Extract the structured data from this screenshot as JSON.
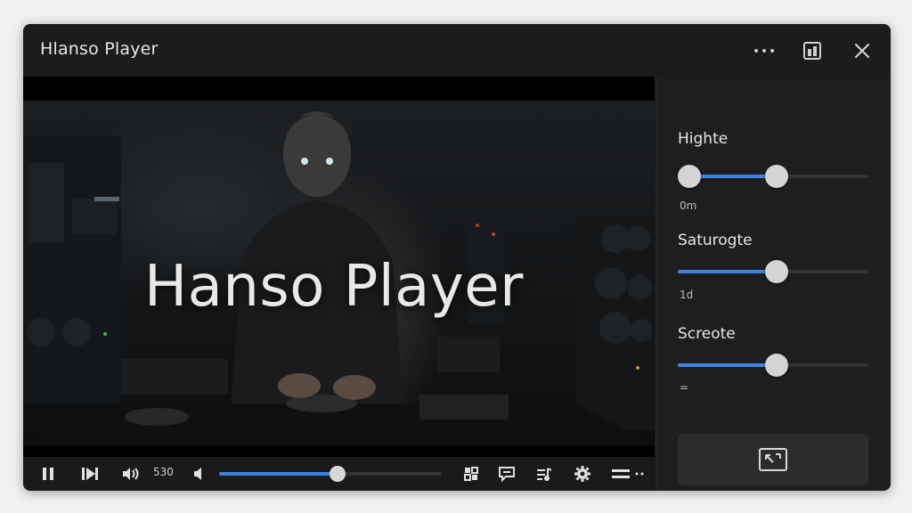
{
  "window": {
    "title": "Hlanso Player"
  },
  "video": {
    "overlay_title": "Hanso Player",
    "progress": 0.5
  },
  "controls": {
    "time": "530",
    "volume": 0.53
  },
  "adjustments": [
    {
      "label": "Highte",
      "value_text": "0m",
      "range": [
        0.06,
        0.52
      ]
    },
    {
      "label": "Saturogte",
      "value_text": "1d",
      "range": [
        0.0,
        0.52
      ]
    },
    {
      "label": "Screote",
      "value_text": "=",
      "range": [
        0.0,
        0.52
      ]
    }
  ],
  "colors": {
    "accent": "#3c82e0",
    "bg": "#161616",
    "panel": "#1e1e1e"
  }
}
